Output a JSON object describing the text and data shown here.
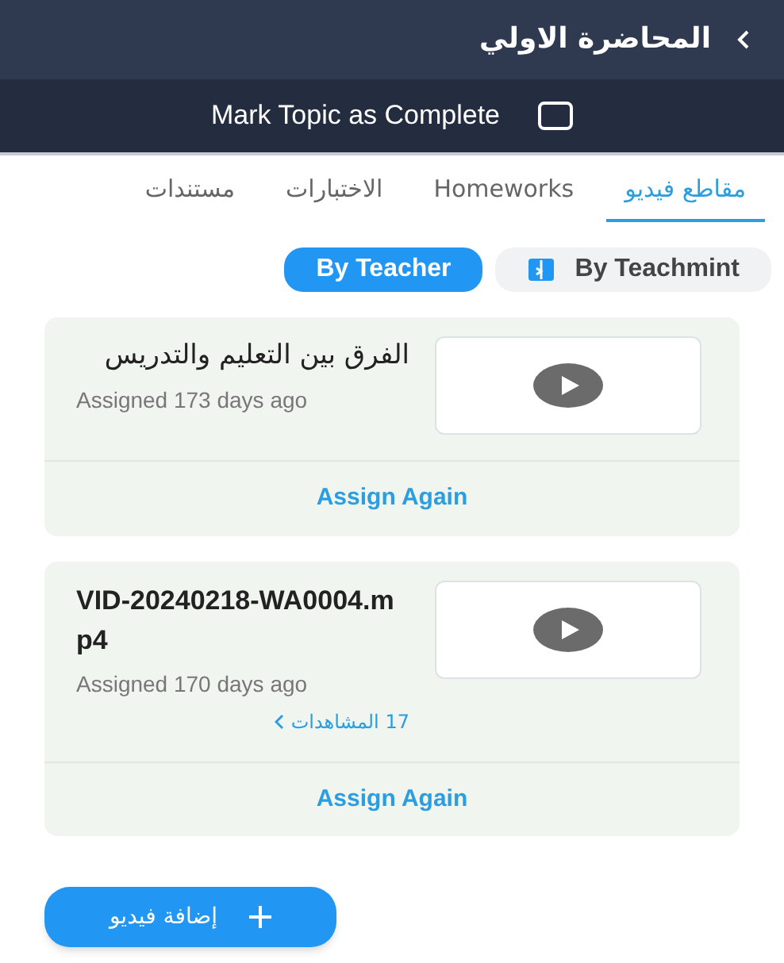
{
  "header": {
    "title": "المحاضرة الاولي"
  },
  "mark_complete": {
    "label": "Mark Topic as Complete",
    "checked": false
  },
  "tabs": [
    {
      "label": "مقاطع فيديو",
      "selected": true
    },
    {
      "label": "Homeworks",
      "selected": false
    },
    {
      "label": "الاختبارات",
      "selected": false
    },
    {
      "label": "مستندات",
      "selected": false
    }
  ],
  "filters": [
    {
      "label": "By Teachmint",
      "selected": false
    },
    {
      "label": "By Teacher",
      "selected": true
    }
  ],
  "videos": [
    {
      "title": "الفرق بين التعليم والتدريس",
      "assigned": "Assigned 173 days ago",
      "action": "Assign Again"
    },
    {
      "title": "VID-20240218-WA0004.mp4",
      "assigned": "Assigned 170 days ago",
      "views": "17 المشاهدات",
      "action": "Assign Again"
    }
  ],
  "add_button": {
    "label": "إضافة فيديو"
  }
}
